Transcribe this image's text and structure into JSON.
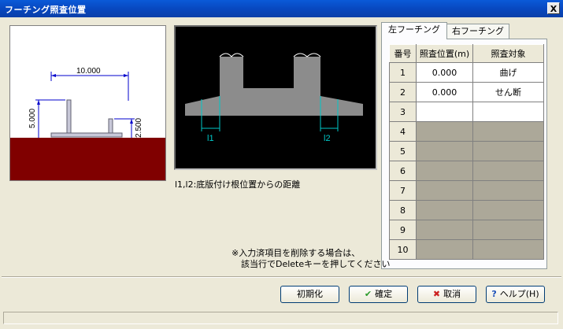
{
  "window": {
    "title": "フーチング照査位置",
    "close_label": "X"
  },
  "preview": {
    "dim_width": "10.000",
    "dim_height_left": "5.000",
    "dim_height_right": "2.500"
  },
  "diagram": {
    "label_l1": "l1",
    "label_l2": "l2",
    "caption": "l1,l2:底版付け根位置からの距離"
  },
  "tabs": [
    {
      "label": "左フーチング",
      "active": true
    },
    {
      "label": "右フーチング",
      "active": false
    }
  ],
  "table": {
    "headers": [
      "番号",
      "照査位置(m)",
      "照査対象"
    ],
    "rows": [
      {
        "no": "1",
        "pos": "0.000",
        "target": "曲げ"
      },
      {
        "no": "2",
        "pos": "0.000",
        "target": "せん断"
      },
      {
        "no": "3",
        "pos": "",
        "target": ""
      },
      {
        "no": "4",
        "pos": "",
        "target": ""
      },
      {
        "no": "5",
        "pos": "",
        "target": ""
      },
      {
        "no": "6",
        "pos": "",
        "target": ""
      },
      {
        "no": "7",
        "pos": "",
        "target": ""
      },
      {
        "no": "8",
        "pos": "",
        "target": ""
      },
      {
        "no": "9",
        "pos": "",
        "target": ""
      },
      {
        "no": "10",
        "pos": "",
        "target": ""
      }
    ]
  },
  "note": {
    "line1": "※入力済項目を削除する場合は、",
    "line2": "該当行でDeleteキーを押してください"
  },
  "buttons": {
    "init": "初期化",
    "ok": "確定",
    "cancel": "取消",
    "help": "ヘルプ(H)"
  },
  "colors": {
    "ground": "#800000",
    "diagram_structure": "#8c8c8c",
    "dim_line": "#0000cc",
    "cyan": "#00c8c8"
  }
}
